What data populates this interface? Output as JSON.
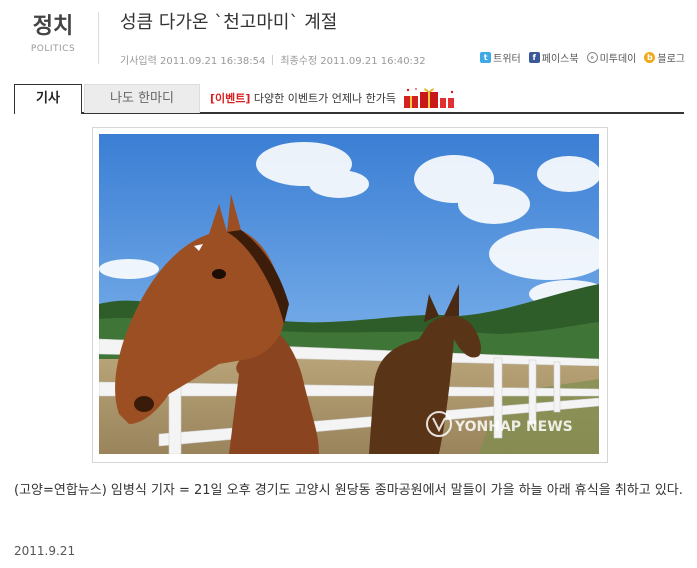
{
  "section": {
    "label_ko": "정치",
    "label_en": "POLITICS"
  },
  "article": {
    "title": "성큼 다가온 `천고마미` 계절",
    "input_label": "기사입력 2011.09.21 16:38:54",
    "modified_label": "최종수정 2011.09.21 16:40:32",
    "body": "(고양=연합뉴스) 임병식 기자 = 21일 오후 경기도 고양시 원당동 종마공원에서 말들이 가을 하늘 아래 휴식을 취하고 있다.",
    "date": "2011.9.21"
  },
  "share": {
    "twitter": "트위터",
    "facebook": "페이스북",
    "me2day": "미투데이",
    "blog": "블로그"
  },
  "tabs": {
    "article": "기사",
    "comment": "나도 한마디"
  },
  "event": {
    "tag": "[이벤트]",
    "text": " 다양한 이벤트가 언제나 한가득"
  },
  "photo": {
    "watermark": "YONHAP NEWS"
  },
  "colors": {
    "event_red": "#d81f1f",
    "sky": "#4a86d8",
    "twitter": "#3ea9e8",
    "facebook": "#3b5998"
  }
}
